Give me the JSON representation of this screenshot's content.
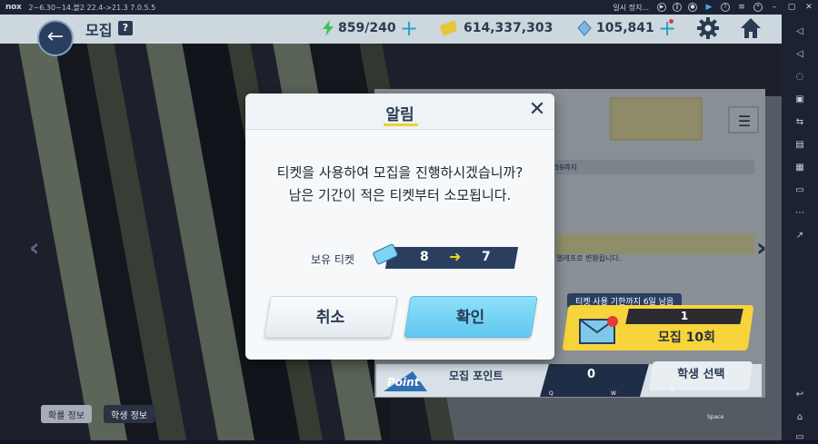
{
  "emulator": {
    "logo": "nox",
    "title": "2~6.30~14.블2 22.4->21.3 7.0.5.5",
    "pause_label": "일시 정지..."
  },
  "topbar": {
    "page_title": "모집",
    "help": "?",
    "ap": "859/240",
    "credits": "614,337,303",
    "gems": "105,841"
  },
  "panel": {
    "date_text": "59까지",
    "convert_text": "엘레프로 변환됩니다.",
    "ticket_notice": "티켓 사용 기한까지 6일 남음",
    "recruit10_count": "1",
    "recruit10_label": "모집 10회",
    "point_logo": "Point",
    "point_label": "모집 포인트",
    "point_value": "0",
    "student_select": "학생 선택",
    "key_q": "Q",
    "key_w": "W",
    "key_e": "E",
    "key_space": "Space"
  },
  "bottom_tabs": {
    "rates": "확률 정보",
    "student_info": "학생 정보"
  },
  "modal": {
    "title": "알림",
    "line1": "티켓을 사용하여 모집을 진행하시겠습니까?",
    "line2": "남은 기간이 적은 티켓부터 소모됩니다.",
    "owned_label": "보유 티켓",
    "ticket_from": "8",
    "ticket_to": "7",
    "cancel": "취소",
    "confirm": "확인"
  },
  "colors": {
    "accent_yellow": "#f3d21e",
    "navy": "#2a3f60",
    "confirm_blue": "#5fc7ef"
  },
  "icons": [
    "back-arrow-icon",
    "ap-lightning-icon",
    "credit-icon",
    "gem-icon",
    "gear-icon",
    "home-icon",
    "menu-icon",
    "close-icon",
    "ticket-icon",
    "mail-icon"
  ]
}
